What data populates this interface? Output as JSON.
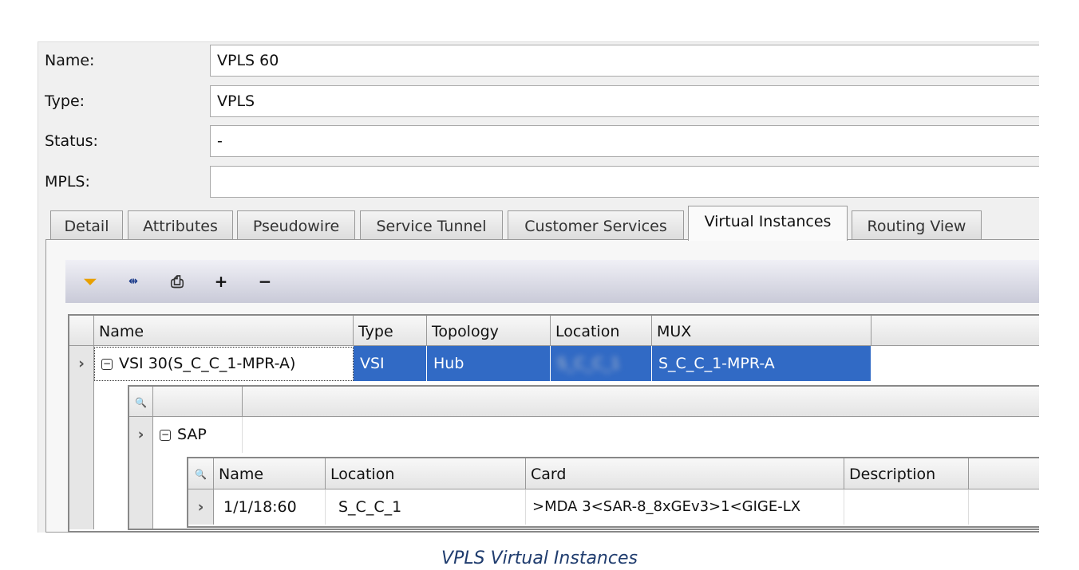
{
  "form": {
    "name_label": "Name:",
    "name_value": "VPLS 60",
    "type_label": "Type:",
    "type_value": "VPLS",
    "status_label": "Status:",
    "status_value": "-",
    "mpls_label": "MPLS:",
    "mpls_value": ""
  },
  "tabs": [
    "Detail",
    "Attributes",
    "Pseudowire",
    "Service Tunnel",
    "Customer Services",
    "Virtual Instances",
    "Routing View"
  ],
  "active_tab": "Virtual Instances",
  "toolbar": {
    "icons": [
      "filter-icon",
      "column-width-icon",
      "print-icon",
      "plus-icon",
      "minus-icon"
    ],
    "plus": "+",
    "minus": "−"
  },
  "instances": {
    "columns": [
      "Name",
      "Type",
      "Topology",
      "Location",
      "MUX"
    ],
    "row": {
      "name": "VSI 30(S_C_C_1-MPR-A)",
      "type": "VSI",
      "topology": "Hub",
      "location": "S_C_C_1",
      "mux": "S_C_C_1-MPR-A"
    }
  },
  "sap_group": {
    "label": "SAP"
  },
  "saps": {
    "columns": [
      "Name",
      "Location",
      "Card",
      "Description"
    ],
    "row": {
      "name": "1/1/18:60",
      "location": "S_C_C_1",
      "card": ">MDA 3<SAR-8_8xGEv3>1<GIGE-LX",
      "description": ""
    }
  },
  "caption": "VPLS Virtual Instances",
  "colors": {
    "selection": "#316AC5",
    "caption": "#1F3C6E"
  }
}
